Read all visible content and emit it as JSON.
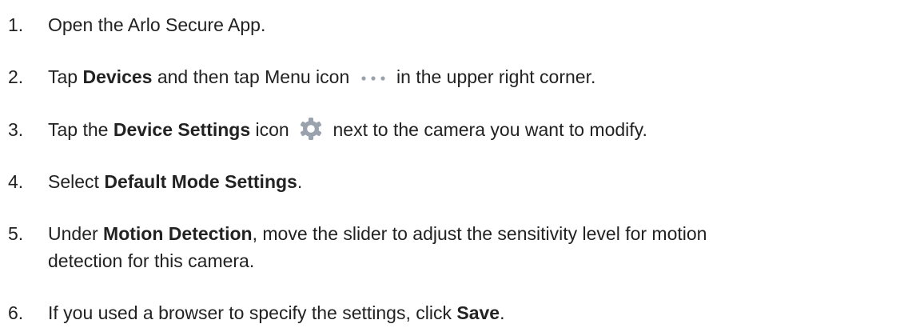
{
  "steps": [
    {
      "number": "1.",
      "text": "Open the Arlo Secure App."
    },
    {
      "number": "2.",
      "pre": "Tap ",
      "bold1": "Devices",
      "mid": " and then tap Menu icon",
      "icon": "more-dots-icon",
      "post": "in the  upper right corner."
    },
    {
      "number": "3.",
      "pre": "Tap the ",
      "bold1": "Device Settings",
      "mid": " icon",
      "icon": "gear-icon",
      "post": "next to the camera you want to modify."
    },
    {
      "number": "4.",
      "pre": "Select ",
      "bold1": "Default Mode Settings",
      "post": "."
    },
    {
      "number": "5.",
      "pre": "Under ",
      "bold1": "Motion Detection",
      "post": ", move the slider to adjust the sensitivity level for motion",
      "line2": "detection for this camera."
    },
    {
      "number": "6.",
      "pre": "If you used a browser to specify the settings, click ",
      "bold1": "Save",
      "post": "."
    }
  ],
  "colors": {
    "text": "#222222",
    "icon": "#9aa3ad"
  }
}
